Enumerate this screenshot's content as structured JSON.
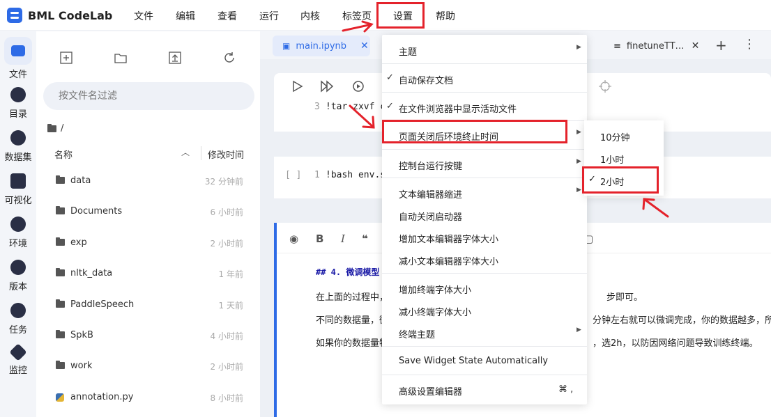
{
  "app": {
    "name": "BML CodeLab"
  },
  "menubar": [
    "文件",
    "编辑",
    "查看",
    "运行",
    "内核",
    "标签页",
    "设置",
    "帮助"
  ],
  "activity": [
    "文件",
    "目录",
    "数据集",
    "可视化",
    "环境",
    "版本",
    "任务",
    "监控"
  ],
  "file_browser": {
    "search_placeholder": "按文件名过滤",
    "path": "/",
    "col_name": "名称",
    "col_modified": "修改时间",
    "files": [
      {
        "name": "data",
        "modified": "32 分钟前",
        "kind": "folder"
      },
      {
        "name": "Documents",
        "modified": "6 小时前",
        "kind": "folder"
      },
      {
        "name": "exp",
        "modified": "2 小时前",
        "kind": "folder"
      },
      {
        "name": "nltk_data",
        "modified": "1 年前",
        "kind": "folder"
      },
      {
        "name": "PaddleSpeech",
        "modified": "1 天前",
        "kind": "folder"
      },
      {
        "name": "SpkB",
        "modified": "4 小时前",
        "kind": "folder"
      },
      {
        "name": "work",
        "modified": "2 小时前",
        "kind": "folder"
      },
      {
        "name": "annotation.py",
        "modified": "8 小时前",
        "kind": "python"
      }
    ]
  },
  "tabs": [
    {
      "label": "main.ipynb",
      "active": true
    },
    {
      "label": "finetuneTT…",
      "active": false
    }
  ],
  "notebook": {
    "code1": {
      "line_no": "3",
      "code": "!tar zxvf c"
    },
    "code2": {
      "prompt": "[ ]",
      "line_no": "1",
      "code": "!bash env.s"
    },
    "markdown": {
      "heading": "## 4. 微调模型",
      "line1_left": "在上面的过程中，",
      "line1_right": "步即可。",
      "line2_left": "不同的数据量，微",
      "line2_right": "分钟左右就可以微调完成，你的数据越多，所需",
      "line3_left": "如果你的数据量特",
      "line3_right": "，选2h，以防因网络问题导致训练终端。"
    }
  },
  "settings_menu": [
    {
      "label": "主题",
      "check": false,
      "submenu": true
    },
    {
      "label": "自动保存文档",
      "check": true,
      "submenu": false
    },
    {
      "label": "在文件浏览器中显示活动文件",
      "check": true,
      "submenu": false
    },
    {
      "label": "页面关闭后环境终止时间",
      "check": false,
      "submenu": true
    },
    {
      "label": "控制台运行按键",
      "check": false,
      "submenu": true
    },
    {
      "label": "文本编辑器缩进",
      "check": false,
      "submenu": true
    },
    {
      "label": "自动关闭启动器",
      "check": false,
      "submenu": false
    },
    {
      "label": "增加文本编辑器字体大小",
      "check": false,
      "submenu": false
    },
    {
      "label": "减小文本编辑器字体大小",
      "check": false,
      "submenu": false
    },
    {
      "label": "增加终端字体大小",
      "check": false,
      "submenu": false
    },
    {
      "label": "减小终端字体大小",
      "check": false,
      "submenu": false
    },
    {
      "label": "终端主题",
      "check": false,
      "submenu": true
    },
    {
      "label": "Save Widget State Automatically",
      "check": false,
      "submenu": false
    },
    {
      "label": "高级设置编辑器",
      "check": false,
      "submenu": false,
      "shortcut": "⌘ ,"
    }
  ],
  "submenu": [
    {
      "label": "10分钟",
      "check": false
    },
    {
      "label": "1小时",
      "check": false
    },
    {
      "label": "2小时",
      "check": true
    }
  ],
  "colors": {
    "accent": "#2e6be6",
    "annotation": "#e4222b"
  }
}
